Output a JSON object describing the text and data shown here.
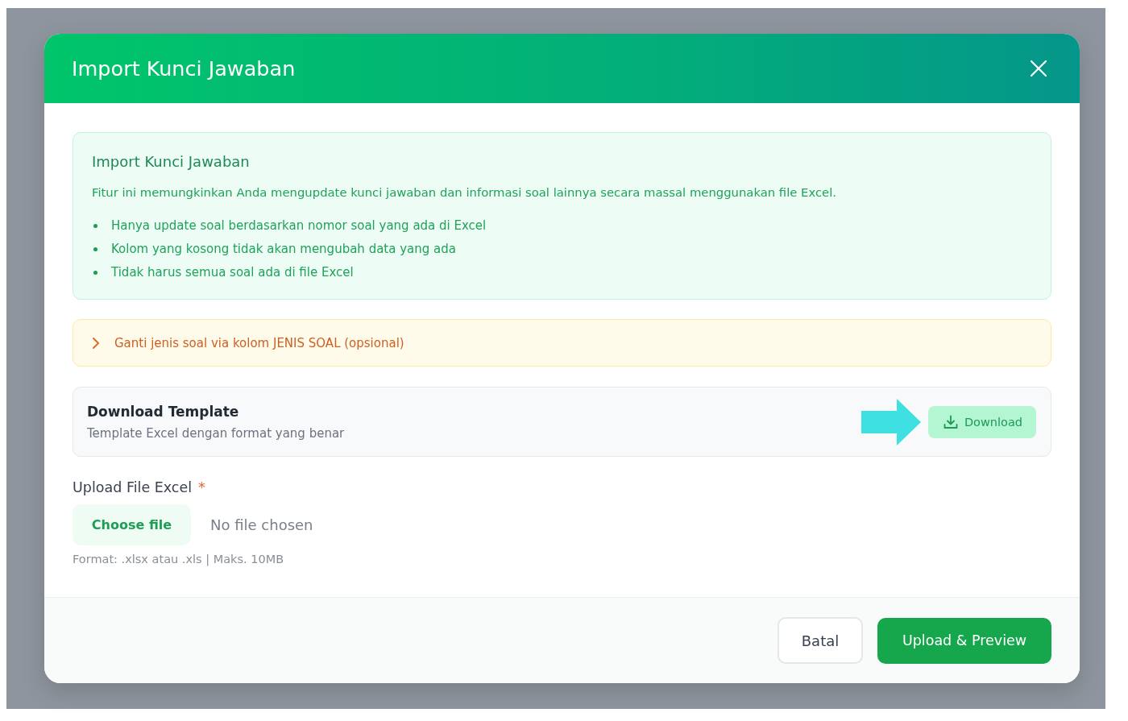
{
  "dialog": {
    "title": "Import Kunci Jawaban"
  },
  "info_box": {
    "title": "Import Kunci Jawaban",
    "description": "Fitur ini memungkinkan Anda mengupdate kunci jawaban dan informasi soal lainnya secara massal menggunakan file Excel.",
    "bullets": [
      "Hanya update soal berdasarkan nomor soal yang ada di Excel",
      "Kolom yang kosong tidak akan mengubah data yang ada",
      "Tidak harus semua soal ada di file Excel"
    ]
  },
  "collapsible": {
    "label": "Ganti jenis soal via kolom JENIS SOAL (opsional)",
    "expanded": false
  },
  "template": {
    "title": "Download Template",
    "subtitle": "Template Excel dengan format yang benar",
    "button": "Download"
  },
  "upload": {
    "label": "Upload File Excel",
    "required_mark": "*",
    "button": "Choose file",
    "status": "No file chosen",
    "hint": "Format: .xlsx atau .xls | Maks. 10MB"
  },
  "footer": {
    "buttons": [
      {
        "label": "Batal",
        "kind": "secondary"
      },
      {
        "label": "Upload & Preview",
        "kind": "primary"
      }
    ]
  }
}
